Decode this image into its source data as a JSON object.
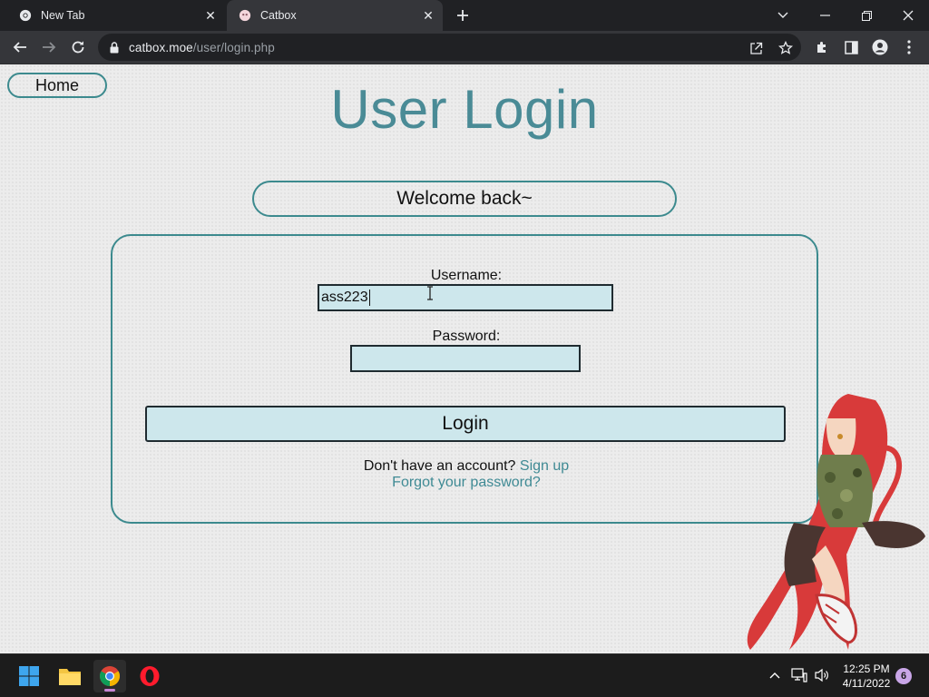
{
  "browser": {
    "tabs": [
      {
        "title": "New Tab",
        "active": false,
        "icon": "chrome-icon"
      },
      {
        "title": "Catbox",
        "active": true,
        "icon": "catbox-favicon"
      }
    ],
    "url_host": "catbox.moe",
    "url_path": "/user/login.php"
  },
  "page": {
    "home_label": "Home",
    "title": "User Login",
    "welcome": "Welcome back~",
    "username_label": "Username:",
    "username_value": "ass223",
    "password_label": "Password:",
    "password_value": "",
    "login_label": "Login",
    "no_account_text": "Don't have an account?",
    "signup_link": "Sign up",
    "forgot_link": "Forgot your password?"
  },
  "colors": {
    "accent": "#3c8a8e",
    "title": "#4a8b96",
    "input_bg": "#cde7ec",
    "page_bg": "#ececec"
  },
  "taskbar": {
    "apps": [
      "windows-start-icon",
      "file-explorer-icon",
      "chrome-icon",
      "opera-icon"
    ],
    "time": "12:25 PM",
    "date": "4/11/2022",
    "notification_count": "6"
  }
}
